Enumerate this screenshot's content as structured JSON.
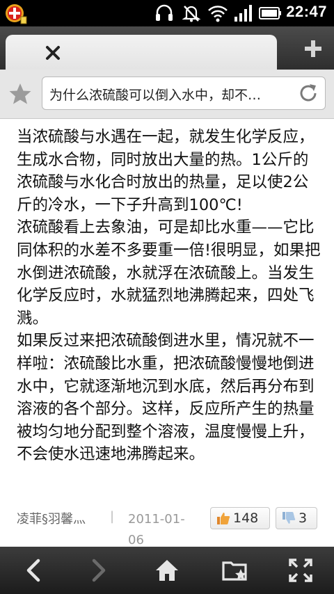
{
  "status_bar": {
    "time": "22:47",
    "icons": [
      "app-badge-icon",
      "headset-icon",
      "mute-icon",
      "wifi-icon",
      "signal-icon",
      "battery-icon"
    ]
  },
  "tabs": {
    "close_icon": "close-icon",
    "new_tab_icon": "plus-icon"
  },
  "url_bar": {
    "title": "为什么浓硫酸可以倒入水中，却不…",
    "bookmark_icon": "star-icon",
    "reload_icon": "reload-icon"
  },
  "article": {
    "text": "当浓硫酸与水遇在一起，就发生化学反应，生成水合物，同时放出大量的热。1公斤的浓硫酸与水化合时放出的热量，足以使2公斤的冷水，一下子升高到100℃!\n浓硫酸看上去象油，可是却比水重——它比同体积的水差不多要重一倍!很明显，如果把水倒进浓硫酸，水就浮在浓硫酸上。当发生化学反应时，水就猛烈地沸腾起来，四处飞溅。\n如果反过来把浓硫酸倒进水里，情况就不一样啦：浓硫酸比水重，把浓硫酸慢慢地倒进水中，它就逐渐地沉到水底，然后再分布到溶液的各个部分。这样，反应所产生的热量被均匀地分配到整个溶液，温度慢慢上升，不会使水迅速地沸腾起来。"
  },
  "answer_meta": {
    "author": "凌菲§羽馨灬",
    "separator": "|",
    "date": "2011-01-06",
    "likes": "148",
    "dislikes": "3"
  },
  "bottom_nav": {
    "icons": [
      "back-icon",
      "forward-icon",
      "home-icon",
      "bookmarks-folder-icon",
      "fullscreen-icon"
    ]
  }
}
